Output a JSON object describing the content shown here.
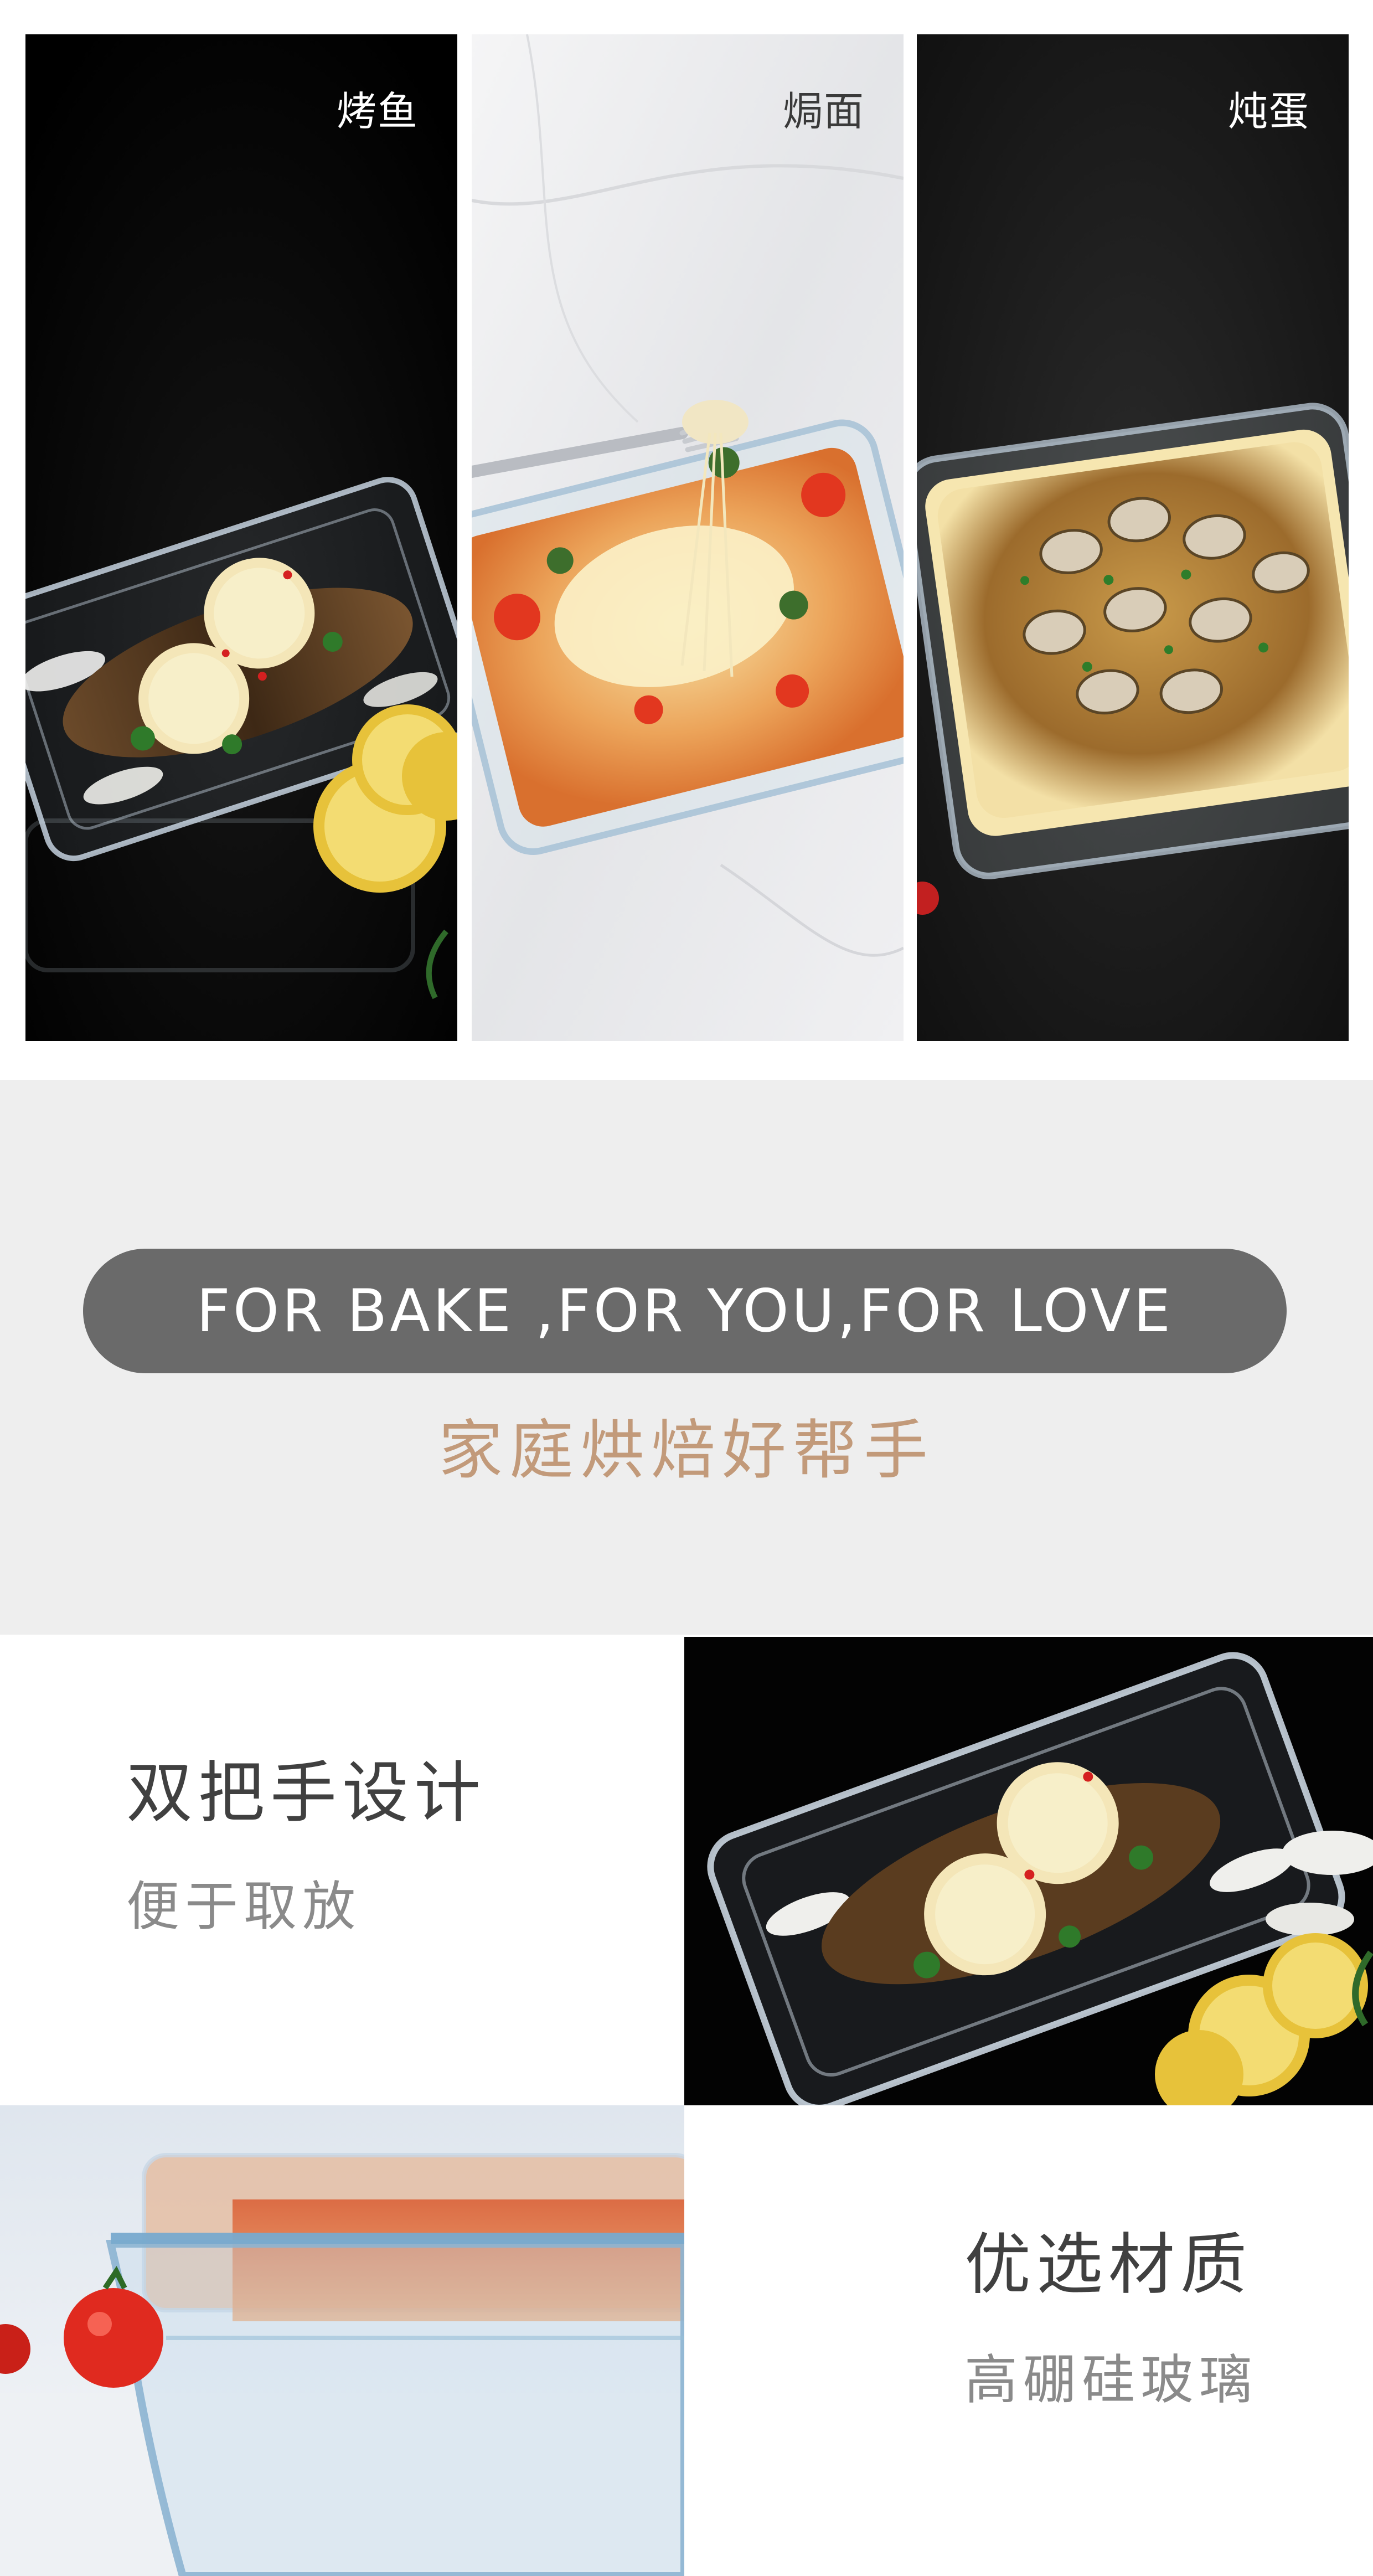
{
  "panels": [
    {
      "label": "烤鱼",
      "label_color": "#ffffff"
    },
    {
      "label": "焗面",
      "label_color": "#3a3a3a"
    },
    {
      "label": "炖蛋",
      "label_color": "#ffffff"
    }
  ],
  "slogan": {
    "english": "FOR BAKE ,FOR YOU,FOR LOVE",
    "chinese": "家庭烘焙好帮手"
  },
  "features": [
    {
      "title": "双把手设计",
      "subtitle": "便于取放"
    },
    {
      "title": "优选材质",
      "subtitle": "高硼硅玻璃"
    }
  ],
  "colors": {
    "band_bg": "#eeeeee",
    "pill_bg": "#6a6a6a",
    "accent_text": "#c29a7a",
    "title_text": "#404040",
    "sub_text": "#8a8a8a"
  }
}
